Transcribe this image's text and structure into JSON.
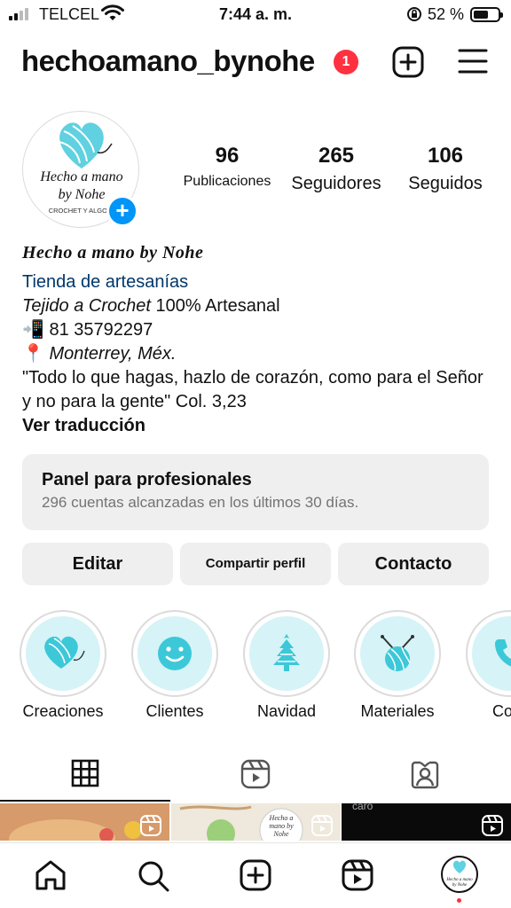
{
  "status_bar": {
    "carrier": "TELCEL",
    "time": "7:44 a. m.",
    "battery_pct": "52 %",
    "battery_level": 0.52
  },
  "header": {
    "username": "hechoamano_bynohe",
    "notif_count": "1"
  },
  "profile": {
    "avatar_text_line1": "Hecho a mano",
    "avatar_text_line2": "by Nohe",
    "avatar_text_line3": "CROCHET Y ALGO M",
    "stats": [
      {
        "value": "96",
        "label": "Publicaciones"
      },
      {
        "value": "265",
        "label": "Seguidores"
      },
      {
        "value": "106",
        "label": "Seguidos"
      }
    ]
  },
  "bio": {
    "name": "Hecho a mano by Nohe",
    "category": "Tienda de artesanías",
    "line1_italic": "Tejido a Crochet",
    "line1_rest": " 100% Artesanal",
    "phone_emoji": "📲",
    "phone": " 81 35792297",
    "pin_emoji": "📍",
    "location": " Monterrey, Méx.",
    "quote": "\"Todo lo que hagas, hazlo de corazón, como para el Señor y no para la gente\" Col. 3,23",
    "translate": "Ver traducción"
  },
  "pro_panel": {
    "title": "Panel para profesionales",
    "subtitle": "296 cuentas alcanzadas en los últimos 30 días."
  },
  "buttons": {
    "edit": "Editar",
    "share": "Compartir perfil",
    "contact": "Contacto"
  },
  "highlights": [
    {
      "label": "Creaciones",
      "icon": "yarn-heart-icon"
    },
    {
      "label": "Clientes",
      "icon": "smiley-icon"
    },
    {
      "label": "Navidad",
      "icon": "christmas-tree-icon"
    },
    {
      "label": "Materiales",
      "icon": "yarn-ball-needles-icon"
    },
    {
      "label": "Cont",
      "icon": "phone-icon"
    }
  ],
  "grid_cells": [
    {
      "caption": ""
    },
    {
      "caption": "Hecho a mano by Nohe"
    },
    {
      "caption": "caro"
    }
  ],
  "colors": {
    "accent_blue": "#0095f6",
    "badge_red": "#ff3040",
    "highlight_bg": "#d6f3f7",
    "highlight_icon": "#3cc8d8",
    "link_blue": "#00376b"
  }
}
